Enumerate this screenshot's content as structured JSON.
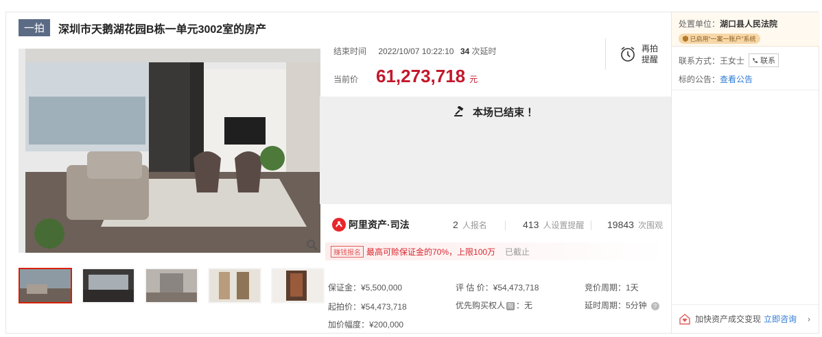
{
  "header": {
    "badge": "一拍",
    "title": "深圳市天鹅湖花园B栋一单元3002室的房产"
  },
  "auction": {
    "end_label": "结束时间",
    "end_time": "2022/10/07 10:22:10",
    "delay_count": "34",
    "delay_label": "次延时",
    "price_label": "当前价",
    "price": "61,273,718",
    "price_unit": "元",
    "remind_label": "再拍提醒",
    "ended_text": "本场已结束 ！"
  },
  "platform": {
    "name": "阿里资产·司法",
    "signups": "2",
    "signups_label": "人报名",
    "reminders": "413",
    "reminders_label": "人设置提醒",
    "views": "19843",
    "views_label": "次围观"
  },
  "deposit": {
    "badge": "赚钱报名",
    "text": "最高可赊保证金的70%，上限100万",
    "status": "已截止"
  },
  "details": {
    "deposit": "保证金：¥5,500,000",
    "appraisal": "评 估 价：¥54,473,718",
    "cycle": "竞价周期：1天",
    "start_price": "起拍价：¥54,473,718",
    "priority_label": "优先购买权人",
    "priority_icon": "限",
    "priority_value": "：无",
    "delay_period": "延时周期：5分钟",
    "increment": "加价幅度：¥200,000"
  },
  "side": {
    "unit_label": "处置单位：",
    "unit": "湖口县人民法院",
    "system_badge": "已启用“一案一账户”系统",
    "contact_label": "联系方式：王女士",
    "contact_btn": "联系",
    "notice_label": "标的公告：",
    "notice_link": "查看公告",
    "promo_text": "加快资产成交变现",
    "promo_link": "立即咨询"
  },
  "colors": {
    "price_red": "#c3182c",
    "link_blue": "#2e7bd6",
    "active_thumb": "#d81e06"
  }
}
